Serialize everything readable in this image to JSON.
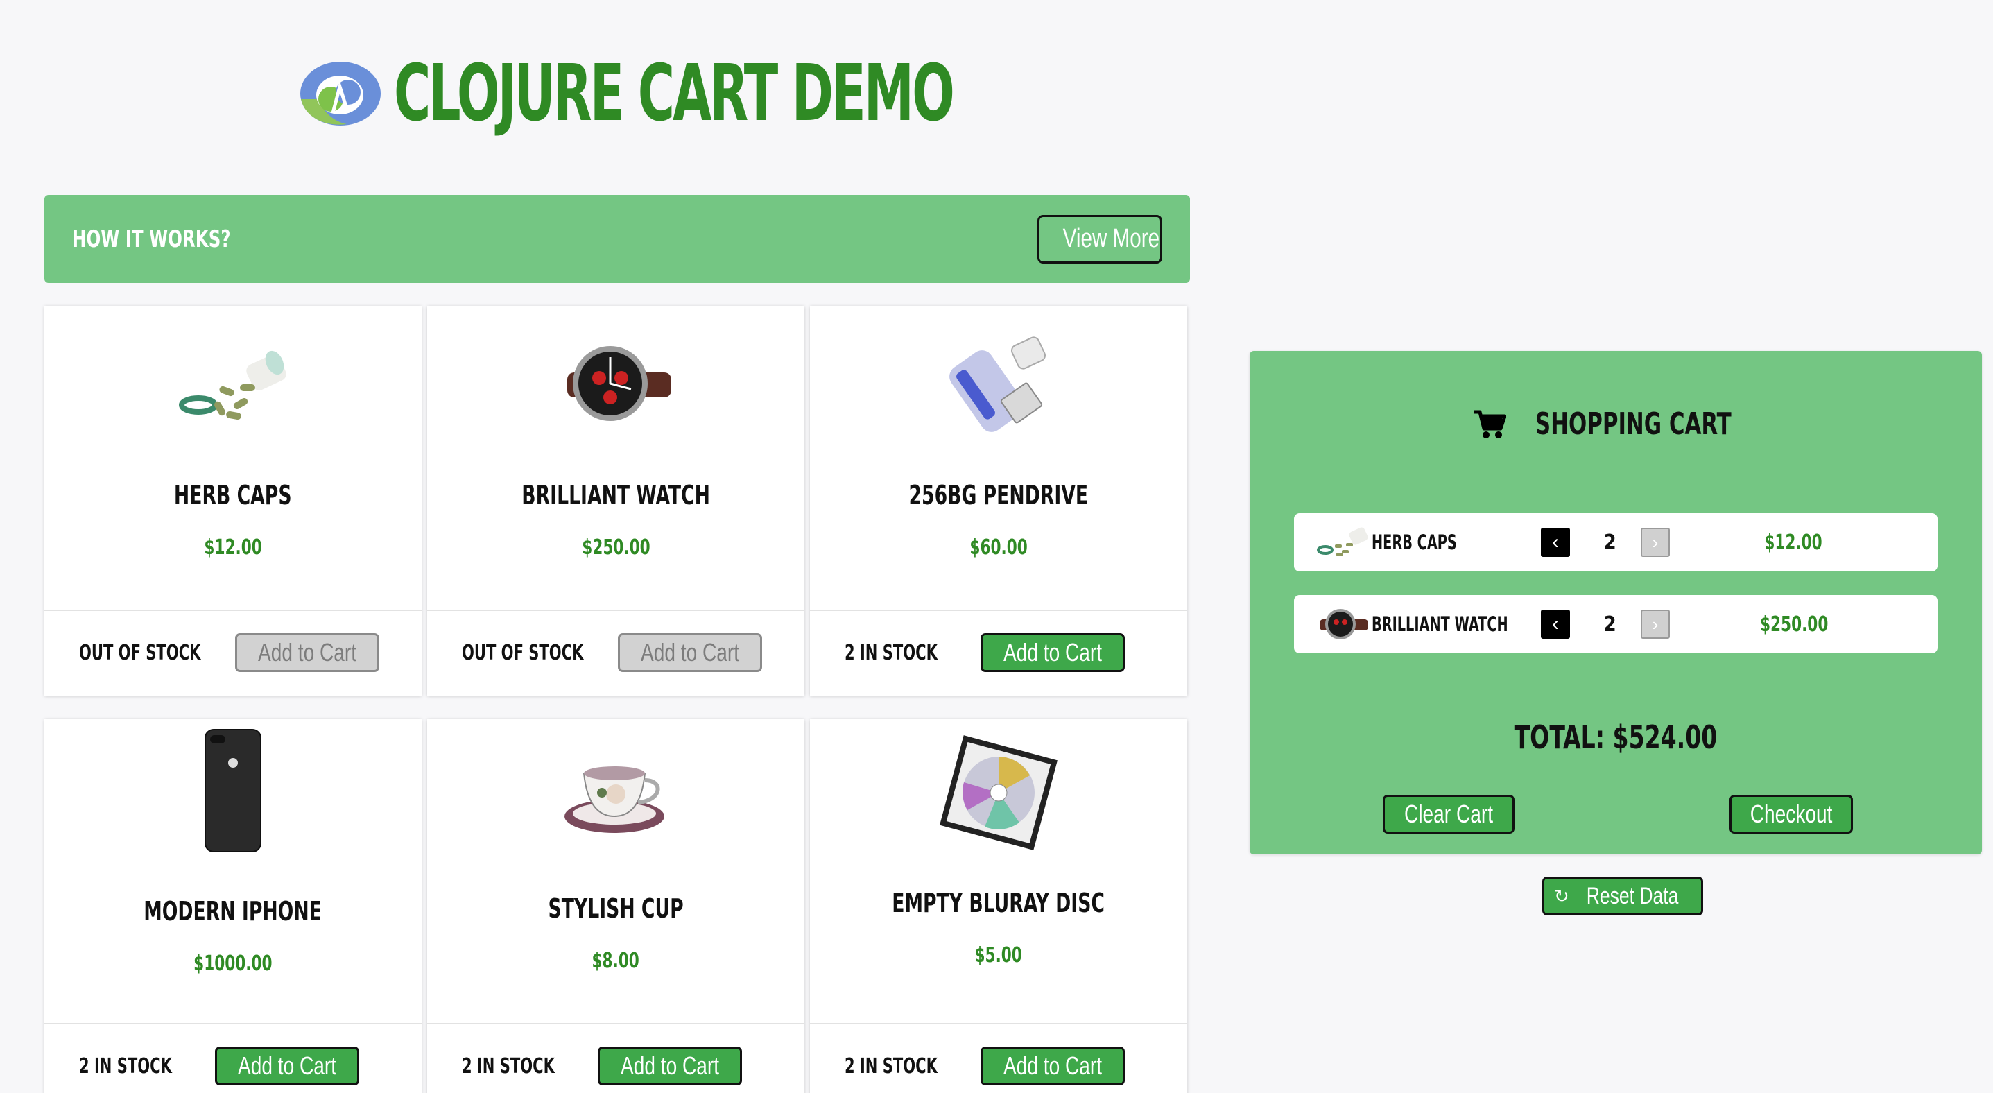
{
  "header": {
    "title": "CLOJURE CART DEMO"
  },
  "how_it_works": {
    "title": "HOW IT WORKS?",
    "button": "View More"
  },
  "products": [
    {
      "name": "HERB CAPS",
      "price": "$12.00",
      "stock": "OUT OF STOCK",
      "button": "Add to Cart",
      "enabled": false,
      "icon": "herb-caps-image"
    },
    {
      "name": "BRILLIANT WATCH",
      "price": "$250.00",
      "stock": "OUT OF STOCK",
      "button": "Add to Cart",
      "enabled": false,
      "icon": "watch-image"
    },
    {
      "name": "256BG PENDRIVE",
      "price": "$60.00",
      "stock": "2 IN STOCK",
      "button": "Add to Cart",
      "enabled": true,
      "icon": "pendrive-image"
    },
    {
      "name": "MODERN IPHONE",
      "price": "$1000.00",
      "stock": "2 IN STOCK",
      "button": "Add to Cart",
      "enabled": true,
      "icon": "iphone-image"
    },
    {
      "name": "STYLISH CUP",
      "price": "$8.00",
      "stock": "2 IN STOCK",
      "button": "Add to Cart",
      "enabled": true,
      "icon": "cup-image"
    },
    {
      "name": "EMPTY BLURAY DISC",
      "price": "$5.00",
      "stock": "2 IN STOCK",
      "button": "Add to Cart",
      "enabled": true,
      "icon": "bluray-disc-image"
    }
  ],
  "cart": {
    "title": "SHOPPING CART",
    "items": [
      {
        "name": "HERB CAPS",
        "qty": "2",
        "price": "$12.00",
        "dec": "‹",
        "inc": "›"
      },
      {
        "name": "BRILLIANT WATCH",
        "qty": "2",
        "price": "$250.00",
        "dec": "‹",
        "inc": "›"
      }
    ],
    "total": "TOTAL: $524.00",
    "clear_button": "Clear Cart",
    "checkout_button": "Checkout"
  },
  "reset": {
    "icon": "↻",
    "label": "Reset Data"
  },
  "colors": {
    "brand_green": "#2f8a24",
    "panel_green": "#74c683",
    "button_green": "#3ea84a"
  }
}
